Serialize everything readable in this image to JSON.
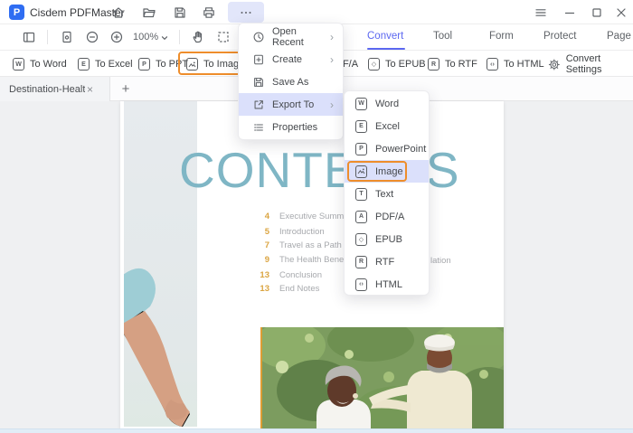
{
  "titlebar": {
    "app_title": "Cisdem PDFMaster",
    "icons": [
      "home",
      "folder-open",
      "save",
      "print",
      "more"
    ],
    "window_controls": [
      "app-menu",
      "minimize",
      "maximize",
      "close"
    ]
  },
  "toolbar": {
    "zoom_level": "100%",
    "tools": [
      "sidebar-toggle",
      "fit-page",
      "zoom-out",
      "zoom-in",
      "hand",
      "marquee-select"
    ],
    "tabs": [
      {
        "label": "Convert",
        "active": true
      },
      {
        "label": "Tool",
        "active": false
      },
      {
        "label": "Form",
        "active": false
      },
      {
        "label": "Protect",
        "active": false
      },
      {
        "label": "Page",
        "active": false
      }
    ]
  },
  "ribbon": {
    "items": [
      {
        "label": "To Word",
        "badge": "W"
      },
      {
        "label": "To Excel",
        "badge": "E"
      },
      {
        "label": "To PPT",
        "badge": "P"
      },
      {
        "label": "To Image",
        "badge": "image",
        "highlighted": true
      },
      {
        "label": "To PDF/A",
        "badge": "A"
      },
      {
        "label": "To EPUB",
        "badge": "◇"
      },
      {
        "label": "To RTF",
        "badge": "R"
      },
      {
        "label": "To HTML",
        "badge": "‹›"
      },
      {
        "label": "Convert Settings",
        "badge": "gear"
      }
    ]
  },
  "doc_tabs": {
    "active_tab": "Destination-Healthy-...",
    "close_glyph": "×",
    "new_tab_glyph": "+"
  },
  "file_menu": {
    "chevron": "›",
    "items": [
      {
        "label": "Open Recent",
        "submenu": true
      },
      {
        "label": "Create",
        "submenu": true
      },
      {
        "label": "Save As",
        "submenu": false
      },
      {
        "label": "Export To",
        "submenu": true,
        "highlighted": true
      },
      {
        "label": "Properties",
        "submenu": false
      }
    ]
  },
  "export_submenu": {
    "items": [
      {
        "label": "Word",
        "badge": "W"
      },
      {
        "label": "Excel",
        "badge": "E"
      },
      {
        "label": "PowerPoint",
        "badge": "P"
      },
      {
        "label": "Image",
        "badge": "image",
        "highlighted": true
      },
      {
        "label": "Text",
        "badge": "T"
      },
      {
        "label": "PDF/A",
        "badge": "A"
      },
      {
        "label": "EPUB",
        "badge": "◇"
      },
      {
        "label": "RTF",
        "badge": "R"
      },
      {
        "label": "HTML",
        "badge": "‹›"
      }
    ]
  },
  "document": {
    "title": "CONTENTS",
    "toc": [
      {
        "page": "4",
        "label": "Executive Summary"
      },
      {
        "page": "5",
        "label": "Introduction"
      },
      {
        "page": "7",
        "label": "Travel as a Path to H"
      },
      {
        "page": "9",
        "label": "The Health Benefits o"
      },
      {
        "page": "13",
        "label": "Conclusion"
      },
      {
        "page": "13",
        "label": "End Notes"
      }
    ],
    "toc_tail_fragment": "lation"
  },
  "colors": {
    "accent_blue": "#5b67f0",
    "menu_highlight": "#dbe0fb",
    "selection_orange": "#ee8d2b",
    "toc_number_orange": "#dba542",
    "title_teal": "#7fb6c5"
  }
}
